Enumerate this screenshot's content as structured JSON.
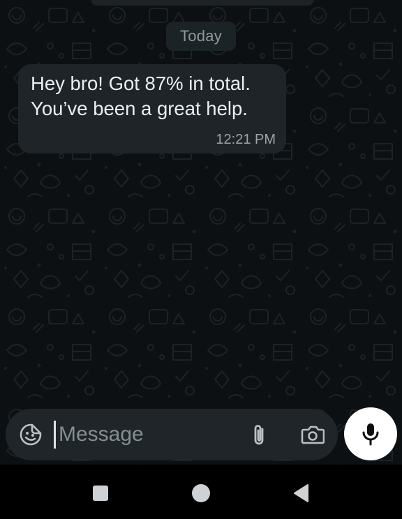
{
  "chat": {
    "date_label": "Today",
    "messages": [
      {
        "lines": [
          "Hey bro! Got 87% in total.",
          "You’ve been a great help."
        ],
        "time": "12:21 PM",
        "direction": "incoming"
      }
    ]
  },
  "composer": {
    "placeholder": "Message",
    "value": "",
    "icons": {
      "emoji": "sticker-smiley-icon",
      "attach": "paperclip-icon",
      "camera": "camera-icon",
      "mic": "microphone-icon"
    }
  },
  "navbar": {
    "icons": [
      "recents-square-icon",
      "home-circle-icon",
      "back-triangle-icon"
    ]
  },
  "colors": {
    "chat_background": "#0c1013",
    "bubble": "#1f2428",
    "composer": "#1f2529",
    "mic_button": "#ffffff",
    "navbar": "#000000"
  }
}
